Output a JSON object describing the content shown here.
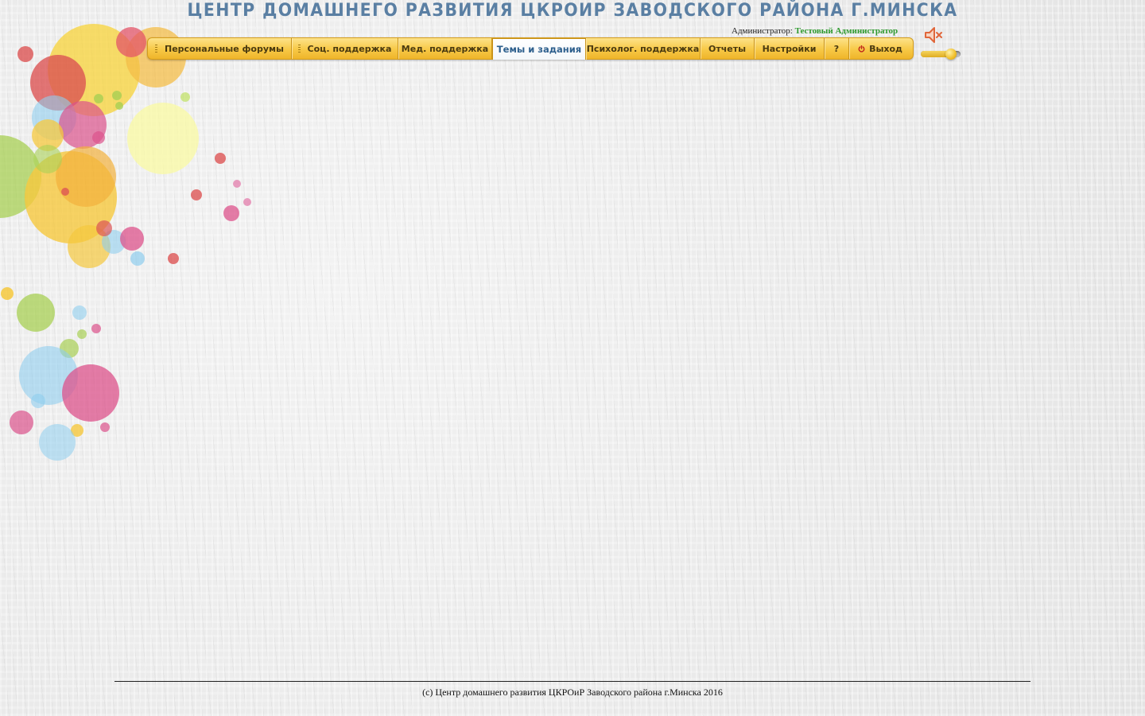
{
  "header": {
    "site_title": "ЦЕНТР ДОМАШНЕГО РАЗВИТИЯ ЦКРОИР ЗАВОДСКОГО РАЙОНА Г.МИНСКА",
    "admin_label": "Администратор:",
    "admin_name": "Тестовый Администратор"
  },
  "nav": {
    "active_index": 3,
    "items": [
      {
        "label": "Персональные форумы",
        "icon": "grip-handle-icon"
      },
      {
        "label": "Соц. поддержка",
        "icon": "grip-handle-icon"
      },
      {
        "label": "Мед. поддержка"
      },
      {
        "label": "Темы и задания"
      },
      {
        "label": "Психолог. поддержка"
      },
      {
        "label": "Отчеты"
      },
      {
        "label": "Настройки"
      },
      {
        "label": "?"
      },
      {
        "label": "Выход",
        "icon": "power-icon"
      }
    ]
  },
  "sound": {
    "icon": "speaker-muted-icon",
    "volume": 0.8
  },
  "footer": {
    "copyright": "(c) Центр домашнего развития ЦКРОиР Заводского района г.Минска 2016"
  },
  "colors": {
    "title": "#5a7fa3",
    "nav_gold": "#f7c846",
    "active_tab_text": "#2d5f8d",
    "admin_name": "#2f9a2f",
    "speaker": "#e0663a"
  }
}
